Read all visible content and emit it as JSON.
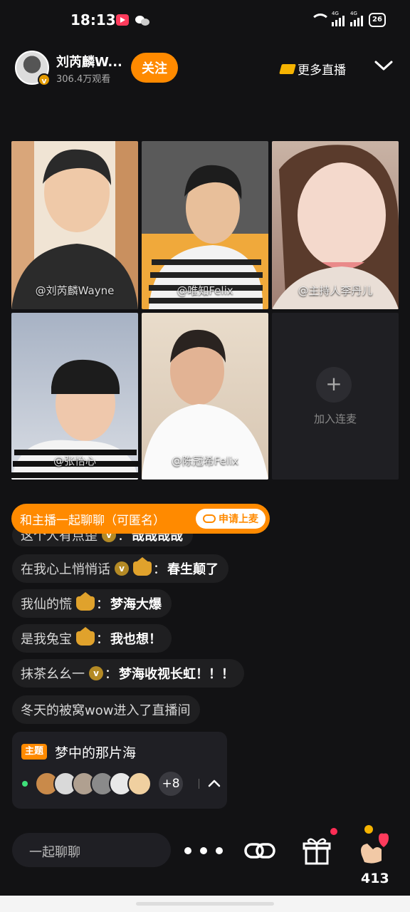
{
  "status": {
    "time": "18:13",
    "network1": "4G",
    "network2": "4G",
    "battery": "26"
  },
  "header": {
    "host_name": "刘芮麟W...",
    "views": "306.4万观看",
    "follow_label": "关注",
    "more_live_label": "更多直播"
  },
  "tiles": [
    {
      "label": "@刘芮麟Wayne"
    },
    {
      "label": "@唯知Felix"
    },
    {
      "label": "@主持人李丹儿"
    },
    {
      "label": "@张怡心"
    },
    {
      "label": "@陈冠希Felix"
    }
  ],
  "join": {
    "plus": "+",
    "label": "加入连麦"
  },
  "banner": {
    "text": "和主播一起聊聊（可匿名）",
    "apply_label": "申请上麦"
  },
  "comments": {
    "partial": {
      "user": "这个人有点歪",
      "text": "哉哉哉哉"
    },
    "items": [
      {
        "user": "在我心上悄悄话",
        "text": "春生颠了"
      },
      {
        "user": "我仙的慌",
        "text": "梦海大爆"
      },
      {
        "user": "是我兔宝",
        "text": "我也想！"
      },
      {
        "user": "抹茶幺幺一",
        "text": "梦海收视长虹！！！"
      }
    ],
    "system": "冬天的被窝wow进入了直播间",
    "badge_v": "v"
  },
  "topic": {
    "tag": "主题",
    "title": "梦中的那片海",
    "more_count": "+8"
  },
  "bottom": {
    "input_placeholder": "一起聊聊",
    "like_count": "413"
  },
  "colors": {
    "accent": "#ff8a00",
    "background": "#121214",
    "online": "#3ee07a"
  }
}
